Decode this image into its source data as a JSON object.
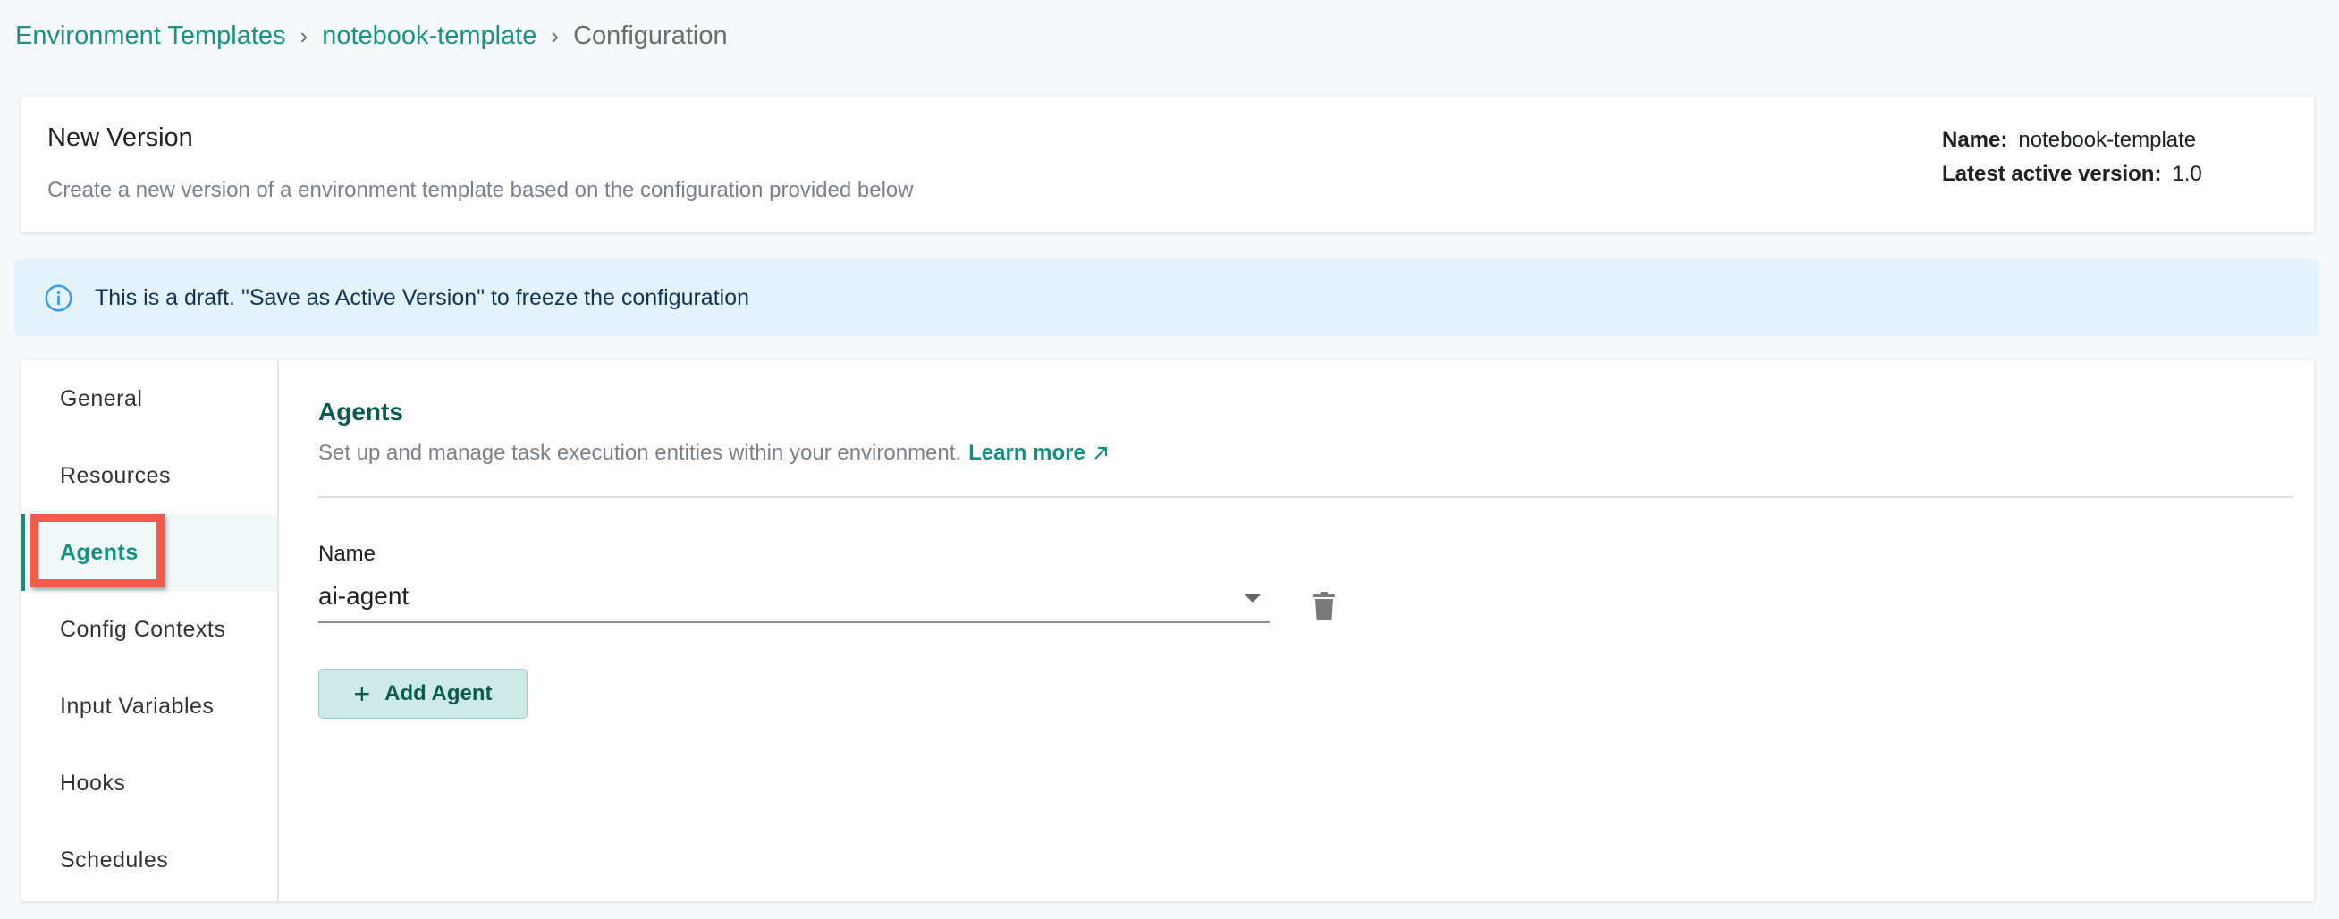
{
  "breadcrumb": {
    "items": [
      {
        "label": "Environment Templates"
      },
      {
        "label": "notebook-template"
      }
    ],
    "current": "Configuration",
    "separator": "›"
  },
  "header": {
    "title": "New Version",
    "description": "Create a new version of a environment template based on the configuration provided below",
    "meta": {
      "name_label": "Name:",
      "name_value": "notebook-template",
      "version_label": "Latest active version:",
      "version_value": "1.0"
    }
  },
  "banner": {
    "icon": "info-icon",
    "text": "This is a draft. \"Save as Active Version\" to freeze the configuration"
  },
  "sidebar": {
    "items": [
      {
        "label": "General"
      },
      {
        "label": "Resources"
      },
      {
        "label": "Agents",
        "active": true
      },
      {
        "label": "Config Contexts"
      },
      {
        "label": "Input Variables"
      },
      {
        "label": "Hooks"
      },
      {
        "label": "Schedules"
      }
    ]
  },
  "agents": {
    "title": "Agents",
    "description": "Set up and manage task execution entities within your environment.",
    "learn_more": "Learn more",
    "field_label": "Name",
    "selected_value": "ai-agent",
    "add_button": "Add Agent",
    "add_icon": "+"
  },
  "colors": {
    "accent": "#15907f",
    "highlight": "#f25a4b",
    "banner_bg": "#e4f2fc"
  }
}
